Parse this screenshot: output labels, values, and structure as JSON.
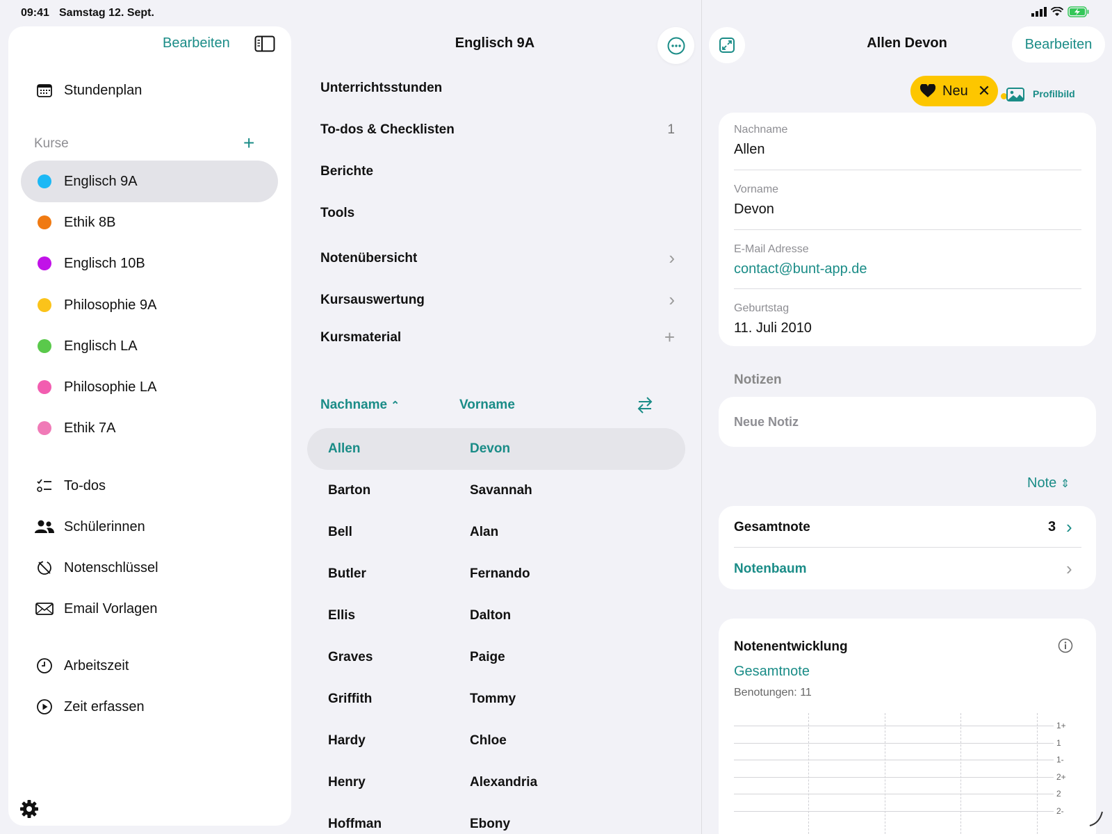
{
  "status": {
    "time": "09:41",
    "date": "Samstag 12. Sept."
  },
  "sidebar": {
    "edit_label": "Bearbeiten",
    "stundenplan_label": "Stundenplan",
    "kurse_header": "Kurse",
    "courses": [
      {
        "label": "Englisch 9A",
        "color": "#1cb8f5",
        "selected": true
      },
      {
        "label": "Ethik 8B",
        "color": "#f07a12"
      },
      {
        "label": "Englisch 10B",
        "color": "#c112e8"
      },
      {
        "label": "Philosophie 9A",
        "color": "#fbc31a"
      },
      {
        "label": "Englisch LA",
        "color": "#5ac94b"
      },
      {
        "label": "Philosophie LA",
        "color": "#f25db0"
      },
      {
        "label": "Ethik 7A",
        "color": "#f07ab7"
      }
    ],
    "tools": [
      {
        "label": "To-dos",
        "icon": "checklist-icon"
      },
      {
        "label": "Schülerinnen",
        "icon": "people-icon"
      },
      {
        "label": "Notenschlüssel",
        "icon": "grade-key-icon"
      },
      {
        "label": "Email Vorlagen",
        "icon": "envelope-icon"
      }
    ],
    "time": [
      {
        "label": "Arbeitszeit",
        "icon": "clock-icon"
      },
      {
        "label": "Zeit erfassen",
        "icon": "play-circle-icon"
      }
    ]
  },
  "middle": {
    "title": "Englisch 9A",
    "menu": [
      {
        "label": "Unterrichtsstunden",
        "trail": ""
      },
      {
        "label": "To-dos & Checklisten",
        "trail": "1"
      },
      {
        "label": "Berichte",
        "trail": ""
      },
      {
        "label": "Tools",
        "trail": ""
      },
      {
        "label": "Notenübersicht",
        "trail": "›"
      },
      {
        "label": "Kursauswertung",
        "trail": "›"
      },
      {
        "label": "Kursmaterial",
        "trail": "+"
      }
    ],
    "sort_lastname": "Nachname",
    "sort_firstname": "Vorname",
    "students": [
      {
        "last": "Allen",
        "first": "Devon",
        "selected": true
      },
      {
        "last": "Barton",
        "first": "Savannah"
      },
      {
        "last": "Bell",
        "first": "Alan"
      },
      {
        "last": "Butler",
        "first": "Fernando"
      },
      {
        "last": "Ellis",
        "first": "Dalton"
      },
      {
        "last": "Graves",
        "first": "Paige"
      },
      {
        "last": "Griffith",
        "first": "Tommy"
      },
      {
        "last": "Hardy",
        "first": "Chloe"
      },
      {
        "last": "Henry",
        "first": "Alexandria"
      },
      {
        "last": "Hoffman",
        "first": "Ebony"
      }
    ]
  },
  "detail": {
    "title": "Allen Devon",
    "edit_label": "Bearbeiten",
    "badge_label": "Neu",
    "profile_label": "Profilbild",
    "fields": [
      {
        "label": "Nachname",
        "value": "Allen"
      },
      {
        "label": "Vorname",
        "value": "Devon"
      },
      {
        "label": "E-Mail Adresse",
        "value": "contact@bunt-app.de"
      },
      {
        "label": "Geburtstag",
        "value": "11. Juli 2010"
      }
    ],
    "notes_title": "Notizen",
    "notes_placeholder": "Neue Notiz",
    "grade_selector": "Note",
    "overall_label": "Gesamtnote",
    "overall_value": "3",
    "tree_label": "Notenbaum",
    "graph_title": "Notenentwicklung",
    "graph_subtitle": "Gesamtnote",
    "graph_count": "Benotungen: 11",
    "y_ticks": [
      "1+",
      "1",
      "1-",
      "2+",
      "2",
      "2-"
    ]
  }
}
